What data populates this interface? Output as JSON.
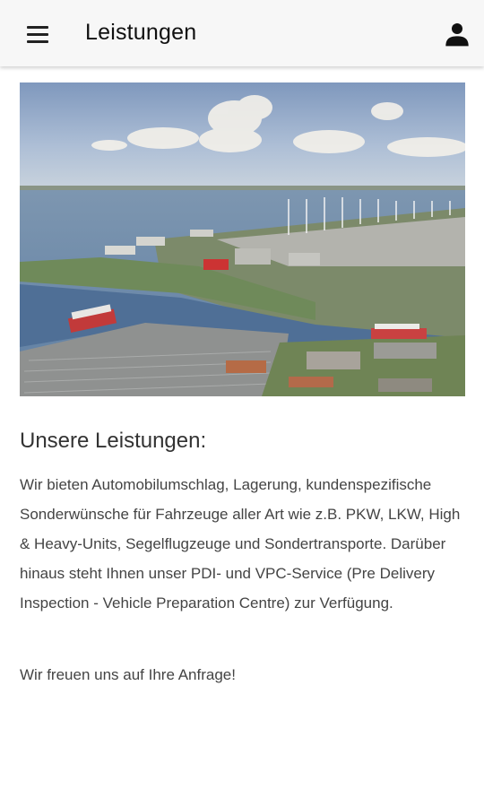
{
  "appbar": {
    "title": "Leistungen",
    "menu_icon": "hamburger-menu-icon",
    "account_icon": "person-icon"
  },
  "hero": {
    "description": "Aerial view of a port with car terminals, ships and wind turbines"
  },
  "content": {
    "heading": "Unsere Leistungen:",
    "body": "Wir bieten Automobilumschlag, Lagerung, kundenspezifische Sonderwünsche für Fahrzeuge aller Art wie z.B. PKW, LKW, High & Heavy-Units, Segelflugzeuge und Sondertransporte. Darüber hinaus steht Ihnen unser PDI- und VPC-Service (Pre Delivery Inspection - Vehicle Preparation Centre) zur Verfügung.",
    "closing": "Wir freuen uns auf Ihre Anfrage!"
  },
  "colors": {
    "appbar_bg": "#f7f7f7",
    "text": "#444444",
    "icon": "#222222"
  }
}
